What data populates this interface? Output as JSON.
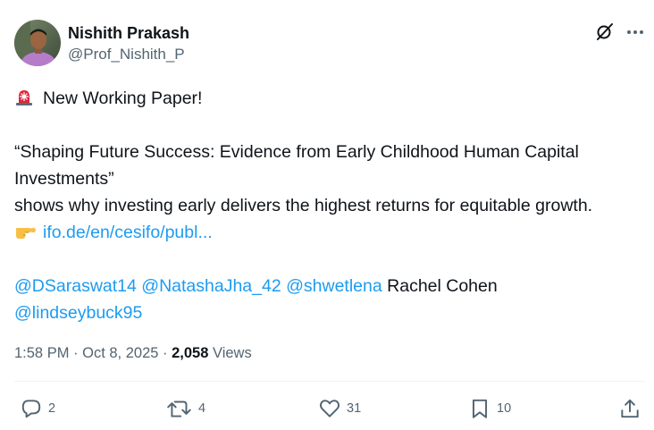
{
  "author": {
    "name": "Nishith Prakash",
    "handle": "@Prof_Nishith_P"
  },
  "tweet": {
    "line1": "New Working Paper!",
    "line2": "“Shaping Future Success: Evidence from Early Childhood Human Capital",
    "line3": "Investments”",
    "line4": "shows why investing early delivers the highest returns for equitable growth.",
    "link_text": "ifo.de/en/cesifo/publ...",
    "mentions": {
      "m1": "@DSaraswat14",
      "m2": "@NatashaJha_42",
      "m3": "@shwetlena",
      "plain_name": "Rachel Cohen",
      "m4": "@lindseybuck95"
    }
  },
  "meta": {
    "time": "1:58 PM",
    "separator": " · ",
    "date": "Oct 8, 2025",
    "views_count": "2,058",
    "views_label": "Views"
  },
  "actions": {
    "replies": "2",
    "reposts": "4",
    "likes": "31",
    "bookmarks": "10"
  },
  "icons": {
    "siren": "rotating-light-emoji",
    "pointer": "backhand-index-pointing-right-emoji",
    "grok": "grok-icon",
    "more": "more-icon"
  },
  "colors": {
    "link": "#1d9bf0",
    "secondary_text": "#536471",
    "primary_text": "#0f1419"
  }
}
